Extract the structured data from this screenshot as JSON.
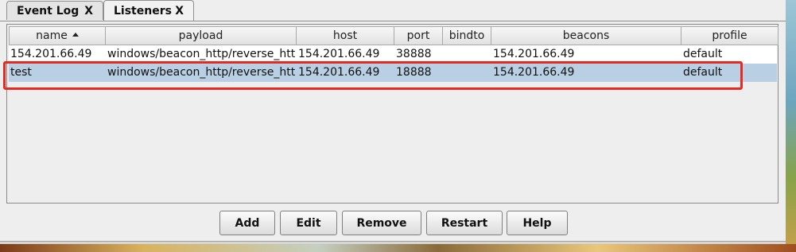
{
  "tabs": [
    {
      "label": "Event Log",
      "close": "X"
    },
    {
      "label": "Listeners",
      "close": "X"
    }
  ],
  "table": {
    "columns": [
      "name",
      "payload",
      "host",
      "port",
      "bindto",
      "beacons",
      "profile"
    ],
    "sorted_column": "name",
    "rows": [
      {
        "name": "154.201.66.49",
        "payload": "windows/beacon_http/reverse_http",
        "host": "154.201.66.49",
        "port": "38888",
        "bindto": "",
        "beacons": "154.201.66.49",
        "profile": "default"
      },
      {
        "name": "test",
        "payload": "windows/beacon_http/reverse_http",
        "host": "154.201.66.49",
        "port": "18888",
        "bindto": "",
        "beacons": "154.201.66.49",
        "profile": "default"
      }
    ],
    "selected_row": 1
  },
  "buttons": {
    "add": "Add",
    "edit": "Edit",
    "remove": "Remove",
    "restart": "Restart",
    "help": "Help"
  },
  "colors": {
    "selection": "#b9cfe4",
    "highlight_annotation": "#e8291f"
  }
}
